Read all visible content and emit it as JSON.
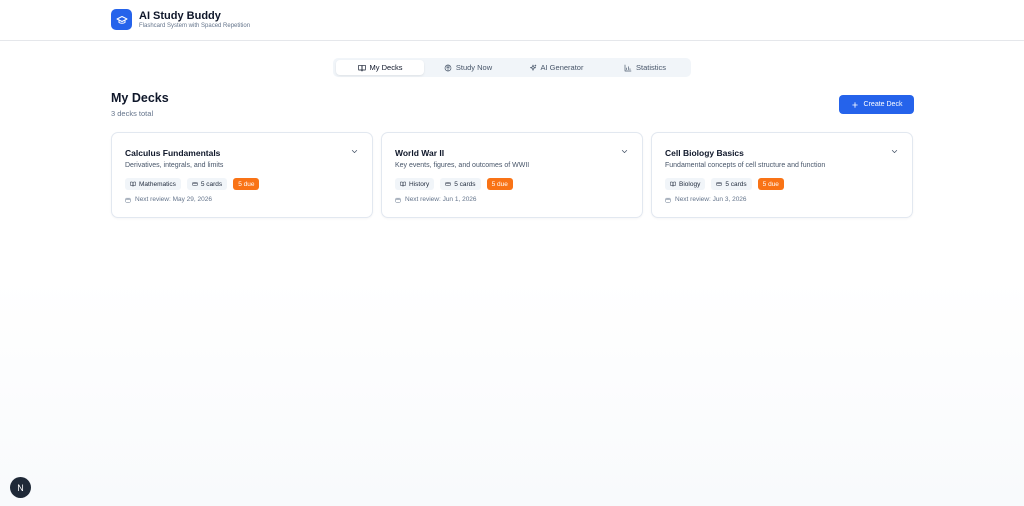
{
  "app": {
    "title": "AI Study Buddy",
    "subtitle": "Flashcard System with Spaced Repetition",
    "logo_icon": "graduation-cap-icon",
    "accent_color": "#2563eb"
  },
  "tabs": [
    {
      "label": "My Decks",
      "icon": "book-open-icon",
      "active": true
    },
    {
      "label": "Study Now",
      "icon": "brain-icon",
      "active": false
    },
    {
      "label": "AI Generator",
      "icon": "sparkles-icon",
      "active": false
    },
    {
      "label": "Statistics",
      "icon": "bar-chart-icon",
      "active": false
    }
  ],
  "section": {
    "title": "My Decks",
    "subtitle": "3 decks total",
    "create_label": "Create Deck"
  },
  "decks": [
    {
      "title": "Calculus Fundamentals",
      "description": "Derivatives, integrals, and limits",
      "subject": "Mathematics",
      "cards": "5 cards",
      "due": "5 due",
      "next_review": "Next review: May 29, 2026"
    },
    {
      "title": "World War II",
      "description": "Key events, figures, and outcomes of WWII",
      "subject": "History",
      "cards": "5 cards",
      "due": "5 due",
      "next_review": "Next review: Jun 1, 2026"
    },
    {
      "title": "Cell Biology Basics",
      "description": "Fundamental concepts of cell structure and function",
      "subject": "Biology",
      "cards": "5 cards",
      "due": "5 due",
      "next_review": "Next review: Jun 3, 2026"
    }
  ],
  "colors": {
    "due_badge": "#f97316",
    "tag_background": "#f1f5f9"
  },
  "devtools_badge": "N"
}
